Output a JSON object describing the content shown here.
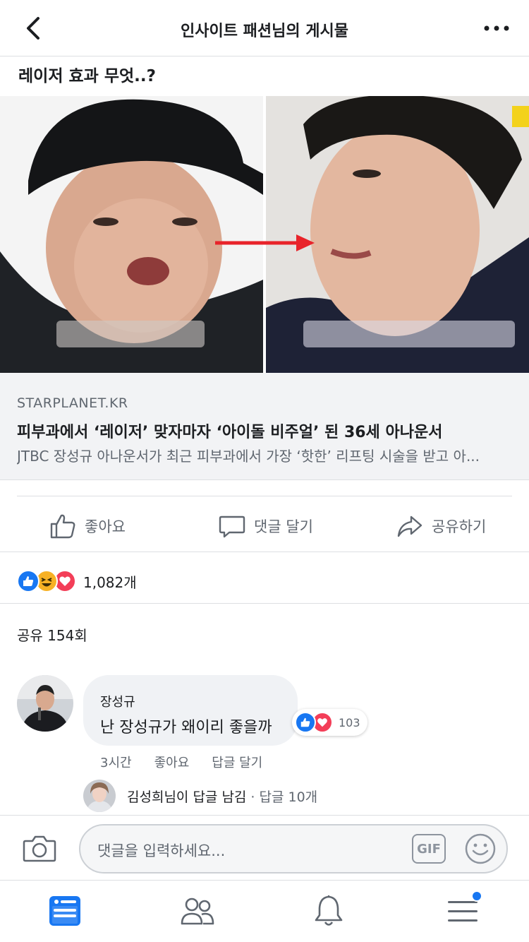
{
  "header": {
    "title": "인사이트 패션님의 게시물"
  },
  "post": {
    "text": "레이저 효과 무엇..?"
  },
  "link": {
    "domain": "STARPLANET.KR",
    "title": "피부과에서 ‘레이저’ 맞자마자 ‘아이돌 비주얼’ 된 36세 아나운서",
    "description": "JTBC 장성규 아나운서가 최근 피부과에서 가장 ‘핫한’ 리프팅 시술을 받고 아..."
  },
  "actions": {
    "like": "좋아요",
    "comment": "댓글 달기",
    "share": "공유하기"
  },
  "reactions": {
    "icons": [
      "like-icon",
      "haha-icon",
      "love-icon"
    ],
    "count": "1,082개"
  },
  "shares": {
    "text": "공유 154회"
  },
  "comment": {
    "author": "장성규",
    "text": "난 장성규가 왜이리 좋을까",
    "reaction_count": "103",
    "time": "3시간",
    "like_label": "좋아요",
    "reply_label": "답글 달기"
  },
  "reply": {
    "text": "김성희님이 답글 남김",
    "count": "· 답글 10개"
  },
  "composer": {
    "placeholder": "댓글을 입력하세요...",
    "gif_label": "GIF"
  },
  "colors": {
    "accent": "#1877f2",
    "like": "#1877f2",
    "love": "#f33e58",
    "haha": "#f7b125",
    "text_secondary": "#606770"
  }
}
